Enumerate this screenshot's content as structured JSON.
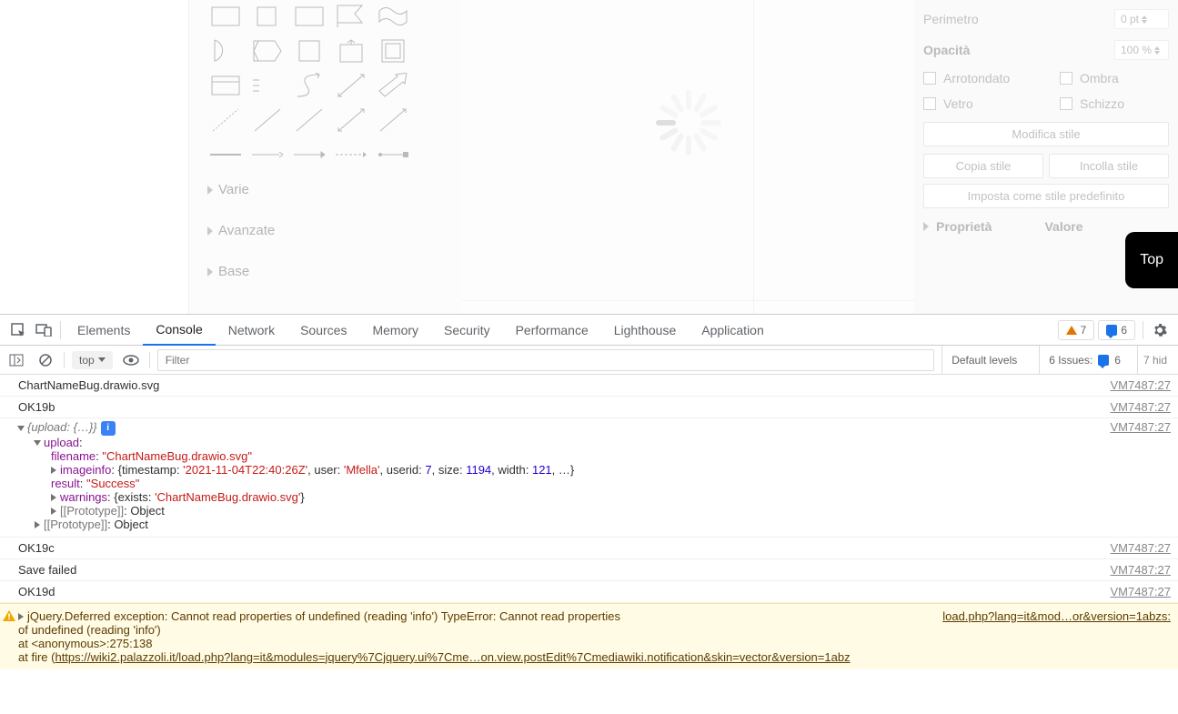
{
  "app": {
    "sections": [
      "Varie",
      "Avanzate",
      "Base"
    ]
  },
  "right": {
    "perimetro_label": "Perimetro",
    "perimetro_value": "0 pt",
    "opacita_label": "Opacità",
    "opacita_value": "100 %",
    "cb_arrotondato": "Arrotondato",
    "cb_ombra": "Ombra",
    "cb_vetro": "Vetro",
    "cb_schizzo": "Schizzo",
    "modifica_stile": "Modifica stile",
    "copia_stile": "Copia stile",
    "incolla_stile": "Incolla stile",
    "imposta_pred": "Imposta come stile predefinito",
    "prop_header": "Proprietà",
    "val_header": "Valore"
  },
  "top_badge": "Top",
  "devtools": {
    "tabs": [
      "Elements",
      "Console",
      "Network",
      "Sources",
      "Memory",
      "Security",
      "Performance",
      "Lighthouse",
      "Application"
    ],
    "active_tab": "Console",
    "warn_count": "7",
    "msg_count": "6",
    "context": "top",
    "filter_placeholder": "Filter",
    "levels": "Default levels",
    "issues_label": "6 Issues:",
    "issues_count": "6",
    "hidden": "7 hid"
  },
  "log": {
    "l1": "ChartNameBug.drawio.svg",
    "src": "VM7487:27",
    "l2": "OK19b",
    "obj_head": "{upload: {…}}",
    "upload_key": "upload",
    "filename_key": "filename",
    "filename_val": "\"ChartNameBug.drawio.svg\"",
    "imageinfo_key": "imageinfo",
    "ii_pre": "{timestamp: ",
    "ii_ts": "'2021-11-04T22:40:26Z'",
    "ii_user_k": ", user: ",
    "ii_user_v": "'Mfella'",
    "ii_uid_k": ", userid: ",
    "ii_uid_v": "7",
    "ii_size_k": ", size: ",
    "ii_size_v": "1194",
    "ii_width_k": ", width: ",
    "ii_width_v": "121",
    "ii_post": ", …}",
    "result_key": "result",
    "result_val": "\"Success\"",
    "warnings_key": "warnings",
    "warn_pre": "{exists: ",
    "warn_val": "'ChartNameBug.drawio.svg'",
    "warn_post": "}",
    "proto": "[[Prototype]]",
    "proto_val": ": Object",
    "l3": "OK19c",
    "l4": "Save failed",
    "l5": "OK19d",
    "warn_src": "load.php?lang=it&mod…or&version=1abzs:",
    "warn1": "jQuery.Deferred exception: Cannot read properties of undefined (reading 'info') TypeError: Cannot read properties",
    "warn2": "of undefined (reading 'info')",
    "warn3": "    at <anonymous>:275:138",
    "warn4_pre": "    at fire (",
    "warn4_link": "https://wiki2.palazzoli.it/load.php?lang=it&modules=jquery%7Cjquery.ui%7Cme…on.view.postEdit%7Cmediawiki.notification&skin=vector&version=1abz"
  }
}
